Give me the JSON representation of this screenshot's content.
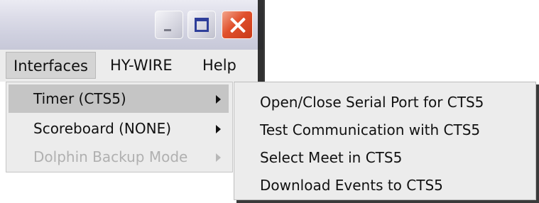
{
  "window": {
    "controls": {
      "minimize": "minimize",
      "maximize": "maximize",
      "close": "close"
    }
  },
  "menubar": {
    "items": [
      {
        "label": "Interfaces",
        "state": "open"
      },
      {
        "label": "HY-WIRE"
      },
      {
        "label": "Help"
      }
    ]
  },
  "interfaces_menu": {
    "items": [
      {
        "label": "Timer (CTS5)",
        "has_submenu": true,
        "highlighted": true,
        "enabled": true
      },
      {
        "label": "Scoreboard (NONE)",
        "has_submenu": true,
        "enabled": true
      },
      {
        "label": "Dolphin Backup Mode",
        "has_submenu": true,
        "enabled": false
      }
    ]
  },
  "timer_submenu": {
    "items": [
      {
        "label": "Open/Close Serial Port for CTS5"
      },
      {
        "label": "Test Communication with CTS5"
      },
      {
        "label": "Select Meet in CTS5"
      },
      {
        "label": "Download Events to CTS5"
      }
    ]
  },
  "colors": {
    "menu_bg": "#ececec",
    "highlight_bg": "#c5c5c5",
    "disabled_text": "#b0b0b0",
    "close_button": "#e0502c",
    "maximize_glyph": "#2f3f9a"
  }
}
